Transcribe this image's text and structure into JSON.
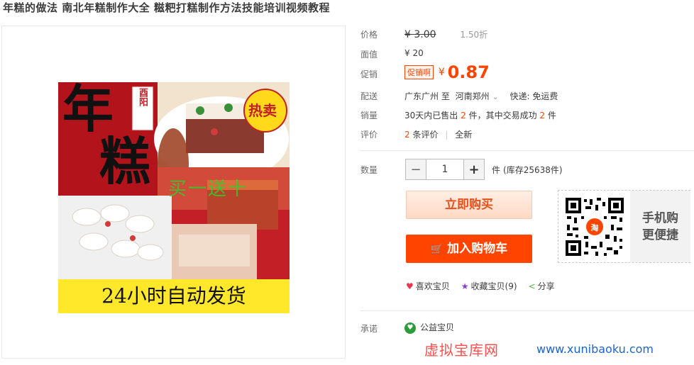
{
  "title": "年糕的做法 南北年糕制作大全 糍粑打糕制作方法技能培训视频教程",
  "product_image": {
    "big_text_1": "年",
    "big_text_2": "糕",
    "seal_text": "酉阳",
    "hot_badge": "热卖",
    "promo_overlay": "买一送十",
    "banner": "24小时自动发货"
  },
  "price": {
    "label": "价格",
    "yen": "¥",
    "value": "3.00",
    "discount": "1.50折"
  },
  "face": {
    "label": "面值",
    "value": "¥ 20"
  },
  "promo": {
    "label": "促销",
    "tag": "促销啊",
    "yen": "¥",
    "value": "0.87"
  },
  "delivery": {
    "label": "配送",
    "from": "广东广州 至",
    "to": "河南郑州",
    "chevron": "⌄",
    "express": "快递: 免运费"
  },
  "sales": {
    "label": "销量",
    "prefix": "30天内已售出",
    "sold": "2",
    "mid": "件，其中交易成功",
    "success": "2",
    "suffix": "件"
  },
  "reviews": {
    "label": "评价",
    "count": "2",
    "count_suffix": "条评价",
    "sep": "|",
    "new": "全新"
  },
  "quantity": {
    "label": "数量",
    "minus": "−",
    "value": "1",
    "plus": "+",
    "unit": "件",
    "stock": "(库存25638件)"
  },
  "buttons": {
    "buy_now": "立即购买",
    "add_cart": "加入购物车",
    "cart_icon": "🛒"
  },
  "mobile": {
    "line1": "手机购",
    "line2": "更便捷",
    "qr_logo": "淘"
  },
  "actions": {
    "like": "喜欢宝贝",
    "favorite": "收藏宝贝(9)",
    "share": "分享"
  },
  "commitment": {
    "label": "承诺",
    "charity": "公益宝贝"
  },
  "watermark": {
    "cn": "虚拟宝库网",
    "url": "www.xunibaoku.com"
  },
  "colors": {
    "accent": "#ff4400",
    "promo": "#f40"
  }
}
